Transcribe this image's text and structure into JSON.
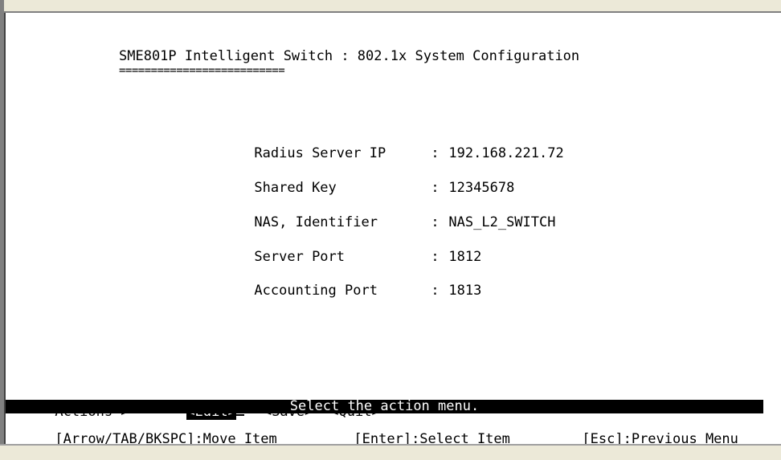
{
  "title": "SME801P Intelligent Switch : 802.1x System Configuration",
  "title_underline": "==========================",
  "fields": [
    {
      "label": "Radius Server IP",
      "value": "192.168.221.72"
    },
    {
      "label": "Shared Key",
      "value": "12345678"
    },
    {
      "label": "NAS, Identifier",
      "value": "NAS_L2_SWITCH"
    },
    {
      "label": "Server Port",
      "value": "1812"
    },
    {
      "label": "Accounting Port",
      "value": "1813"
    }
  ],
  "separator": ":",
  "actions": {
    "label": "Actions->",
    "items": [
      "<Edit>",
      "<Save>",
      "<Quit>"
    ],
    "selected_index": 0
  },
  "status_message": "Select the action menu.",
  "help": [
    "[Arrow/TAB/BKSPC]:Move Item",
    "[Enter]:Select Item",
    "[Esc]:Previous Menu"
  ],
  "colors": {
    "terminal_bg": "#ffffff",
    "terminal_fg": "#000000",
    "highlight_bg": "#000000",
    "highlight_fg": "#ffffff"
  }
}
